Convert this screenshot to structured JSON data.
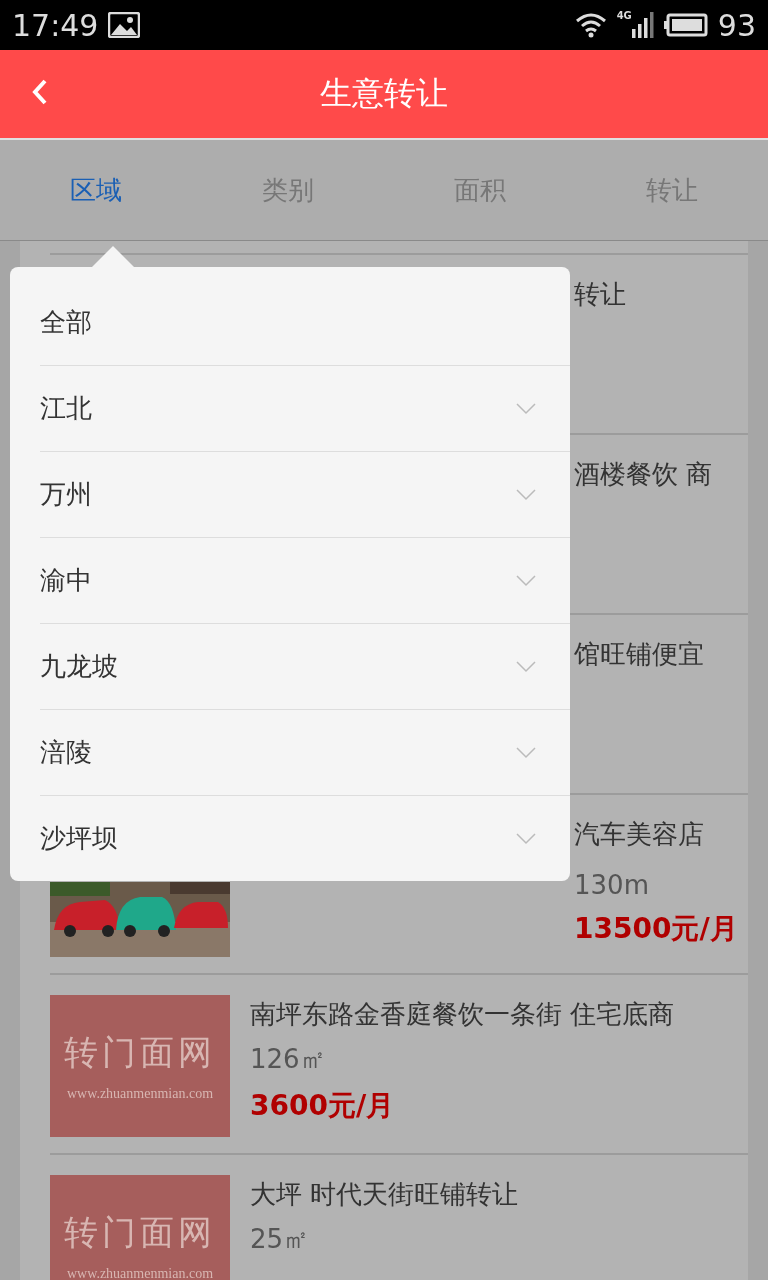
{
  "status_bar": {
    "time": "17:49",
    "network": "4G",
    "battery": "93"
  },
  "header": {
    "title": "生意转让"
  },
  "tabs": [
    {
      "label": "区域",
      "selected": true
    },
    {
      "label": "类别",
      "selected": false
    },
    {
      "label": "面积",
      "selected": false
    },
    {
      "label": "转让",
      "selected": false
    }
  ],
  "listings": [
    {
      "title": "转让",
      "covered": true
    },
    {
      "title": "酒楼餐饮 商",
      "covered": true
    },
    {
      "title": "馆旺铺便宜",
      "covered": true
    },
    {
      "title": "汽车美容店",
      "covered": true,
      "area": "130m",
      "price": "13500元/月"
    },
    {
      "title": "南坪东路金香庭餐饮一条街 住宅底商",
      "covered": false,
      "area": "126㎡",
      "price": "3600元/月",
      "thumb": {
        "kind": "placeholder",
        "logo": "转门面网",
        "url": "www.zhuanmenmian.com"
      }
    },
    {
      "title": "大坪 时代天街旺铺转让",
      "covered": false,
      "area": "25㎡",
      "thumb": {
        "kind": "placeholder",
        "logo": "转门面网",
        "url": "www.zhuanmenmian.com"
      }
    }
  ],
  "dropdown": {
    "items": [
      {
        "label": "全部",
        "has_children": false
      },
      {
        "label": "江北",
        "has_children": true
      },
      {
        "label": "万州",
        "has_children": true
      },
      {
        "label": "渝中",
        "has_children": true
      },
      {
        "label": "九龙坡",
        "has_children": true
      },
      {
        "label": "涪陵",
        "has_children": true
      },
      {
        "label": "沙坪坝",
        "has_children": true
      }
    ]
  }
}
